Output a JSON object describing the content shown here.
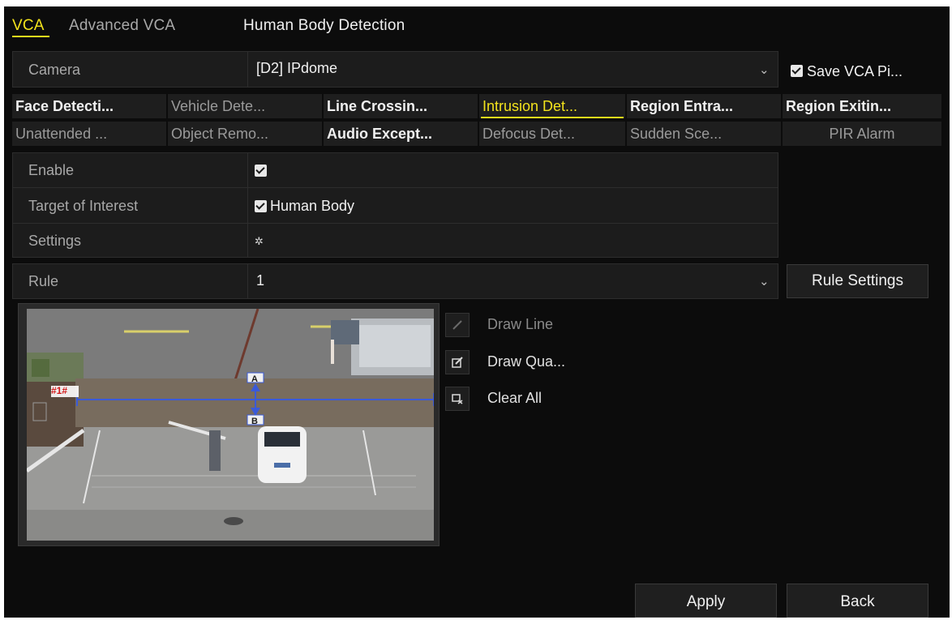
{
  "tabs": [
    {
      "label": "VCA"
    },
    {
      "label": "Advanced VCA"
    },
    {
      "label": "Human Body Detection"
    }
  ],
  "camera": {
    "label": "Camera",
    "value": "[D2] IPdome",
    "save_pic_label": "Save VCA Pi..."
  },
  "events": [
    {
      "label": "Face Detecti..."
    },
    {
      "label": "Vehicle Dete..."
    },
    {
      "label": "Line Crossin..."
    },
    {
      "label": "Intrusion Det..."
    },
    {
      "label": "Region Entra..."
    },
    {
      "label": "Region Exitin..."
    },
    {
      "label": "Unattended ..."
    },
    {
      "label": "Object Remo..."
    },
    {
      "label": "Audio Except..."
    },
    {
      "label": "Defocus Det..."
    },
    {
      "label": "Sudden Sce..."
    },
    {
      "label": "PIR Alarm"
    }
  ],
  "settings": {
    "enable_label": "Enable",
    "enable_checked": true,
    "target_label": "Target of Interest",
    "target_value": "Human Body",
    "settings_label": "Settings",
    "settings_icon": "gear-icon"
  },
  "rule": {
    "label": "Rule",
    "value": "1",
    "settings_button": "Rule Settings"
  },
  "preview": {
    "region_tag": "#1#",
    "point_a": "A",
    "point_b": "B"
  },
  "tools": {
    "draw_line": "Draw Line",
    "draw_quad": "Draw Qua...",
    "clear_all": "Clear All"
  },
  "footer": {
    "apply": "Apply",
    "back": "Back"
  },
  "colors": {
    "accent": "#f2e21c",
    "background": "#0c0c0c",
    "rule_line": "#3a5ad8",
    "tag_red": "#d21a1a"
  }
}
